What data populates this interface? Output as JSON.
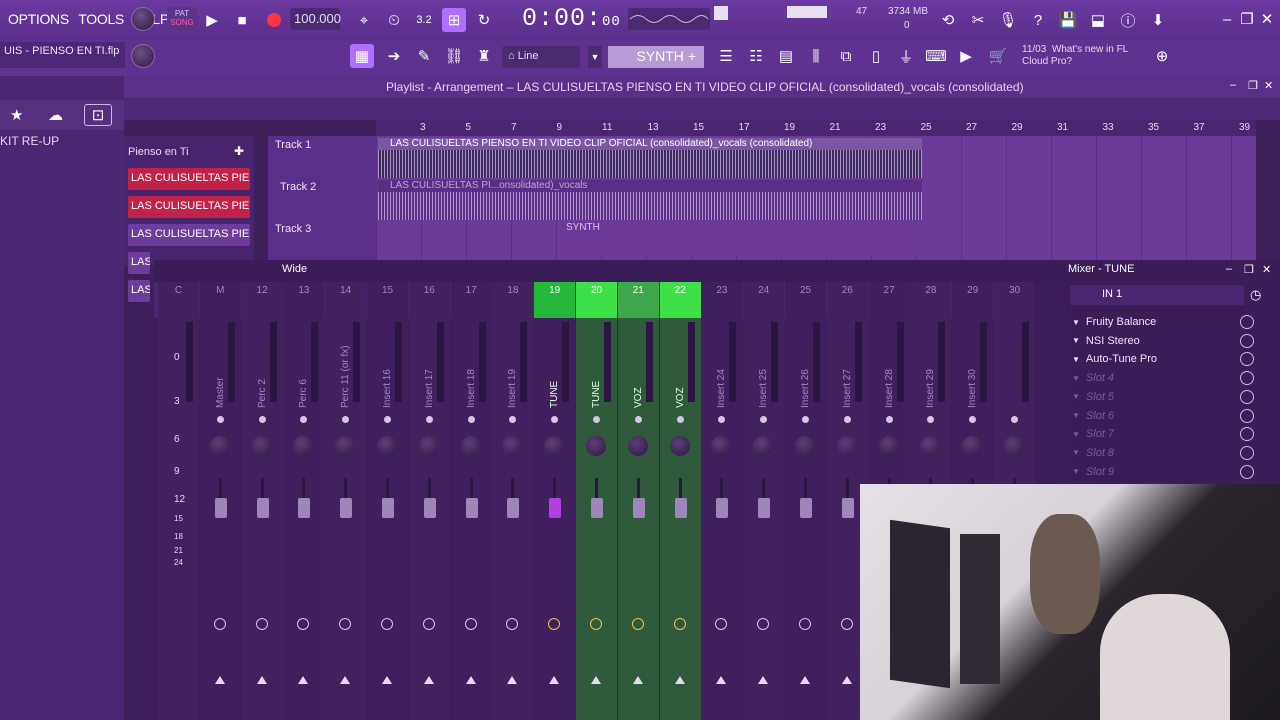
{
  "menu": [
    "OPTIONS",
    "TOOLS",
    "HELP"
  ],
  "transport": {
    "pat_song_top": "PAT",
    "pat_song_bottom": "SONG",
    "tempo": "100.000",
    "time_main": "0:00:",
    "time_small": "00",
    "cpu_value": "47",
    "memory": "3734 MB",
    "polyphony": "0"
  },
  "file_title": "UIS - PIENSO EN TI.flp",
  "toolbar2": {
    "snap_label": "Line",
    "channel_label": "SYNTH",
    "news_date": "11/03",
    "news_text_1": "What's new in FL",
    "news_text_2": "Cloud Pro?"
  },
  "browser": {
    "item": "KIT RE-UP"
  },
  "playlist": {
    "title": "Playlist - Arrangement – LAS CULISUELTAS PIENSO EN TI VIDEO CLIP OFICIAL (consolidated)_vocals (consolidated)",
    "ruler": [
      "3",
      "5",
      "7",
      "9",
      "11",
      "13",
      "15",
      "17",
      "19",
      "21",
      "23",
      "25",
      "27",
      "29",
      "31",
      "33",
      "35",
      "37",
      "39"
    ],
    "pattern": "Pienso en Ti",
    "channels": [
      {
        "label": "LAS CULISUELTAS PIEN...",
        "color": "red"
      },
      {
        "label": "LAS CULISUELTAS PIEN...",
        "color": "red"
      },
      {
        "label": "LAS CULISUELTAS PIEN...",
        "color": "purple"
      },
      {
        "label": "LAS C",
        "color": "purple"
      },
      {
        "label": "LAS C",
        "color": "purple"
      }
    ],
    "tracks": [
      "Track 1",
      "Track 2",
      "Track 3"
    ],
    "clip1": "LAS CULISUELTAS PIENSO EN TI VIDEO CLIP OFICIAL (consolidated)_vocals (consolidated)",
    "clip2": "LAS CULISUELTAS PI...onsolidated)_vocals",
    "synth_clip": "SYNTH"
  },
  "mixer": {
    "mode": "Wide",
    "title": "Mixer - TUNE",
    "input": "IN 1",
    "db_scale": [
      "0",
      "3",
      "6",
      "9",
      "12",
      "15",
      "18",
      "21",
      "24"
    ],
    "strips": [
      {
        "num": "C",
        "name": ""
      },
      {
        "num": "M",
        "name": "Master"
      },
      {
        "num": "12",
        "name": "Perc 2"
      },
      {
        "num": "13",
        "name": "Perc 6"
      },
      {
        "num": "14",
        "name": "Perc 11 (or fx)"
      },
      {
        "num": "15",
        "name": "Insert 16"
      },
      {
        "num": "16",
        "name": "Insert 17"
      },
      {
        "num": "17",
        "name": "Insert 18"
      },
      {
        "num": "18",
        "name": "Insert 19"
      },
      {
        "num": "19",
        "name": "TUNE"
      },
      {
        "num": "20",
        "name": "TUNE"
      },
      {
        "num": "21",
        "name": "VOZ"
      },
      {
        "num": "22",
        "name": "VOZ"
      },
      {
        "num": "23",
        "name": "Insert 24"
      },
      {
        "num": "24",
        "name": "Insert 25"
      },
      {
        "num": "25",
        "name": "Insert 26"
      },
      {
        "num": "26",
        "name": "Insert 27"
      },
      {
        "num": "27",
        "name": "Insert 28"
      },
      {
        "num": "28",
        "name": "Insert 29"
      },
      {
        "num": "29",
        "name": "Insert 30"
      },
      {
        "num": "30",
        "name": ""
      }
    ],
    "slots": [
      "Fruity Balance",
      "NSI Stereo",
      "Auto-Tune Pro",
      "Slot 4",
      "Slot 5",
      "Slot 6",
      "Slot 7",
      "Slot 8",
      "Slot 9"
    ]
  }
}
